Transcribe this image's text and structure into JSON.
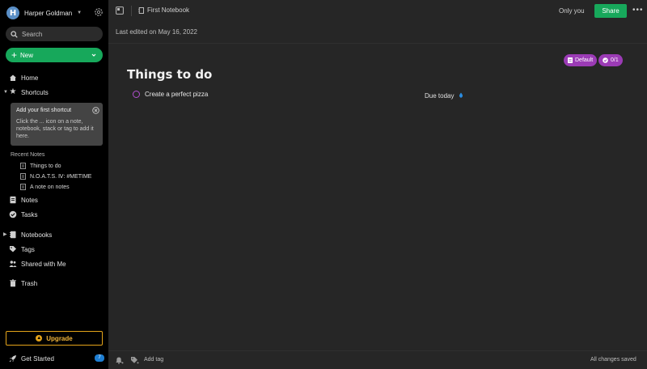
{
  "sidebar": {
    "account": {
      "initial": "H",
      "name": "Harper Goldman"
    },
    "search_label": "Search",
    "new_label": "New",
    "nav": {
      "home": "Home",
      "shortcuts": "Shortcuts",
      "notes": "Notes",
      "tasks": "Tasks",
      "notebooks": "Notebooks",
      "tags": "Tags",
      "shared": "Shared with Me",
      "trash": "Trash"
    },
    "shortcut_hint": {
      "title": "Add your first shortcut",
      "body": "Click the ... icon on a note, notebook, stack or tag to add it here."
    },
    "recent_heading": "Recent Notes",
    "recent_notes": [
      "Things to do",
      "N.O.A.T.S. Ⅳ: #METIME",
      "A note on notes"
    ],
    "upgrade_label": "Upgrade",
    "getting_started": {
      "label": "Get Started",
      "badge": "7"
    }
  },
  "toolbar": {
    "notebook_label": "First Notebook",
    "visibility": "Only you",
    "share_label": "Share",
    "more_label": "•••"
  },
  "note": {
    "last_edited": "Last edited on May 16, 2022",
    "tags": [
      {
        "label": "Default",
        "icon": "document-icon"
      },
      {
        "label": "0/1",
        "icon": "check-circle-icon"
      }
    ],
    "title": "Things to do",
    "tasks": [
      {
        "text": "Create a perfect pizza",
        "due": "Due today",
        "done": false
      }
    ]
  },
  "footer": {
    "add_tag": "Add tag",
    "save_status": "All changes saved"
  },
  "colors": {
    "accent_green": "#17a85b",
    "upgrade_gold": "#e5a41a",
    "tag_purple": "#9b3bb5",
    "badge_blue": "#1e7ed2"
  }
}
